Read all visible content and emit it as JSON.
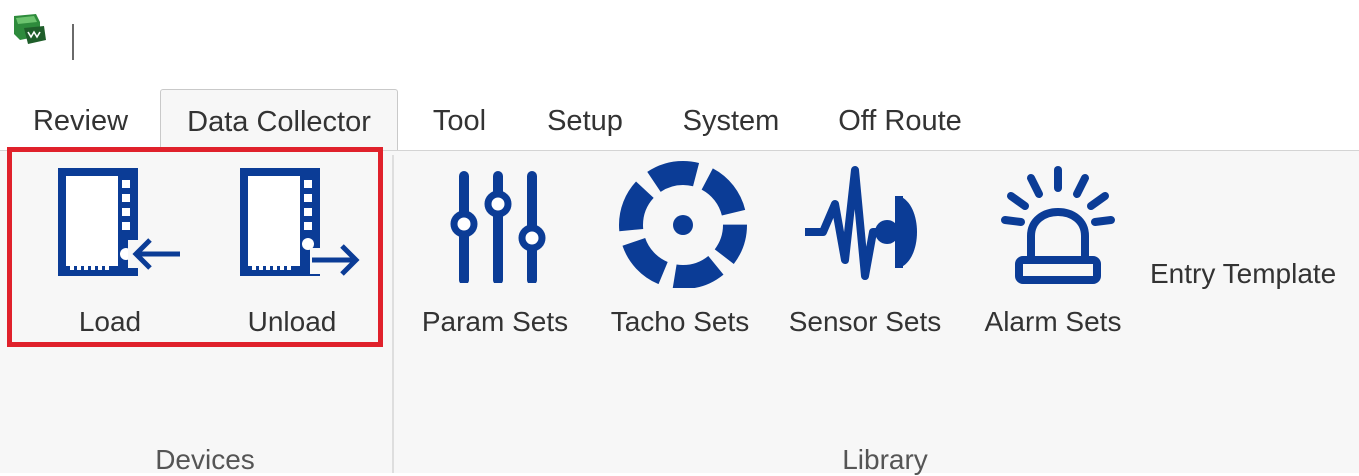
{
  "tabs": [
    "Review",
    "Data Collector",
    "Tool",
    "Setup",
    "System",
    "Off Route"
  ],
  "active_tab": "Data Collector",
  "groups": {
    "devices": {
      "label": "Devices",
      "buttons": {
        "load": "Load",
        "unload": "Unload"
      }
    },
    "library": {
      "label": "Library",
      "buttons": {
        "param_sets": "Param Sets",
        "tacho_sets": "Tacho Sets",
        "sensor_sets": "Sensor Sets",
        "alarm_sets": "Alarm Sets",
        "entry_template": "Entry Template"
      }
    }
  },
  "colors": {
    "icon_blue": "#0b3c96",
    "highlight": "#e0212b",
    "app_icon_green": "#2e8b3c"
  },
  "icons": {
    "app": "app-icon",
    "load": "device-load-icon",
    "unload": "device-unload-icon",
    "param_sets": "sliders-icon",
    "tacho_sets": "tacho-dial-icon",
    "sensor_sets": "sensor-waveform-icon",
    "alarm_sets": "alarm-beacon-icon"
  }
}
